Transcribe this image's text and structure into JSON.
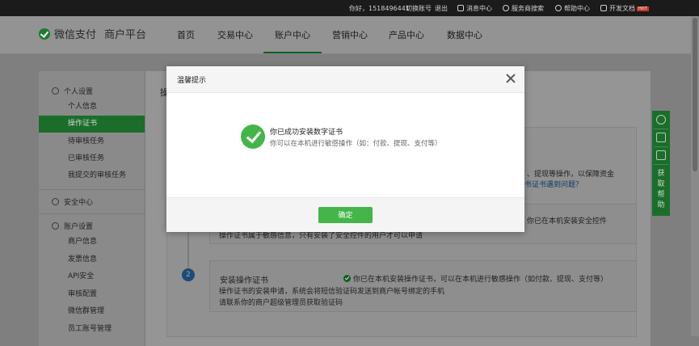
{
  "topbar": {
    "greeting": "你好，1518496441",
    "switch_account": "切换账号",
    "logout": "退出",
    "messages": "消息中心",
    "provider_search": "服务商搜索",
    "help": "帮助中心",
    "dev_docs": "开发文档",
    "dev_docs_badge": "HOT"
  },
  "header": {
    "brand": "微信支付",
    "platform": "商户平台",
    "nav": [
      "首页",
      "交易中心",
      "账户中心",
      "营销中心",
      "产品中心",
      "数据中心"
    ],
    "active_nav": "账户中心"
  },
  "sidebar": {
    "group_personal": "个人设置",
    "personal_items": [
      "个人信息",
      "操作证书",
      "待审核任务",
      "已审核任务",
      "我提交的审核任务"
    ],
    "active_item": "操作证书",
    "group_security": "安全中心",
    "group_account": "账户设置",
    "account_items": [
      "商户信息",
      "发票信息",
      "API安全",
      "审核配置",
      "微信群管理",
      "员工账号管理"
    ]
  },
  "background": {
    "heading_fragment": "操",
    "intro_line1": "、提现等操作，以保障资金",
    "intro_link": "书证书遇到问题？",
    "step1_partial_status": "你已在本机安装安全控件",
    "step1_partial_desc": "操作证书属于敏感信息，只有安装了安全控件的用户才可以申请",
    "step2_number": "2",
    "step2_title": "安装操作证书",
    "step2_status": "你已在本机安装操作证书，可以在本机进行敏感操作（如付款、提现、支付等）",
    "step2_desc_line1": "操作证书的安装申请，系统会将短信验证码发送到商户帐号绑定的手机",
    "step2_desc_line2": "请联系你的商户超级管理员获取验证码"
  },
  "floating_panel": {
    "label": "获取帮助"
  },
  "modal": {
    "title": "温馨提示",
    "message": "你已成功安装数字证书",
    "sub_message": "你可以在本机进行敏感操作（如：付款、提现、支付等）",
    "confirm": "确定"
  },
  "colors": {
    "brand_green": "#44b549",
    "active_green": "#1b6e2a",
    "step_blue": "#1d4b75",
    "topbar_bg": "#1b1b1b"
  }
}
